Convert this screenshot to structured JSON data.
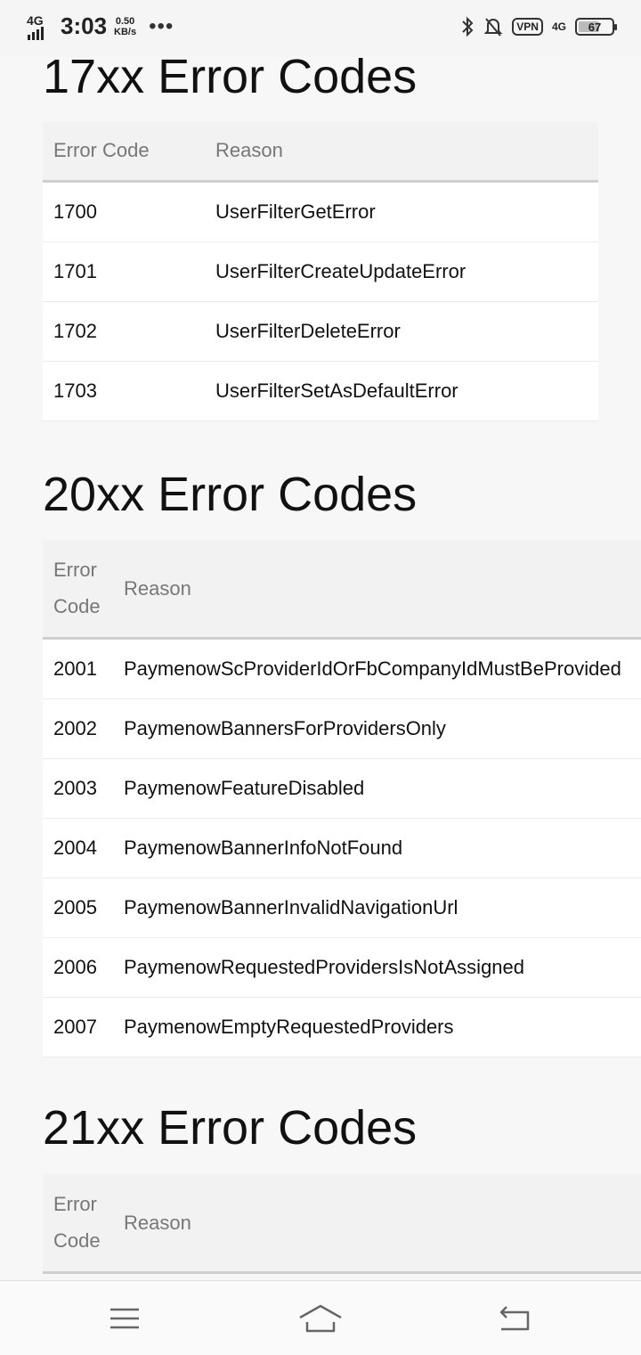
{
  "status_bar": {
    "network_left": "4G",
    "time": "3:03",
    "speed_value": "0.50",
    "speed_unit": "KB/s",
    "dots": "•••",
    "vpn_label": "VPN",
    "network_right": "4G",
    "battery": "67",
    "battery_level": 0.67
  },
  "sections": [
    {
      "title": "17xx Error Codes",
      "header": {
        "code": "Error Code",
        "reason": "Reason"
      },
      "rows": [
        {
          "code": "1700",
          "reason": "UserFilterGetError"
        },
        {
          "code": "1701",
          "reason": "UserFilterCreateUpdateError"
        },
        {
          "code": "1702",
          "reason": "UserFilterDeleteError"
        },
        {
          "code": "1703",
          "reason": "UserFilterSetAsDefaultError"
        }
      ]
    },
    {
      "title": "20xx Error Codes",
      "header": {
        "code_line1": "Error",
        "code_line2": "Code",
        "reason": "Reason"
      },
      "rows": [
        {
          "code": "2001",
          "reason": "PaymenowScProviderIdOrFbCompanyIdMustBeProvided"
        },
        {
          "code": "2002",
          "reason": "PaymenowBannersForProvidersOnly"
        },
        {
          "code": "2003",
          "reason": "PaymenowFeatureDisabled"
        },
        {
          "code": "2004",
          "reason": "PaymenowBannerInfoNotFound"
        },
        {
          "code": "2005",
          "reason": "PaymenowBannerInvalidNavigationUrl"
        },
        {
          "code": "2006",
          "reason": "PaymenowRequestedProvidersIsNotAssigned"
        },
        {
          "code": "2007",
          "reason": "PaymenowEmptyRequestedProviders"
        }
      ]
    },
    {
      "title": "21xx Error Codes",
      "header": {
        "code_line1": "Error",
        "code_line2": "Code",
        "reason": "Reason"
      }
    }
  ],
  "nav": {
    "menu_icon": "menu-icon",
    "home_icon": "home-icon",
    "back_icon": "back-icon"
  }
}
